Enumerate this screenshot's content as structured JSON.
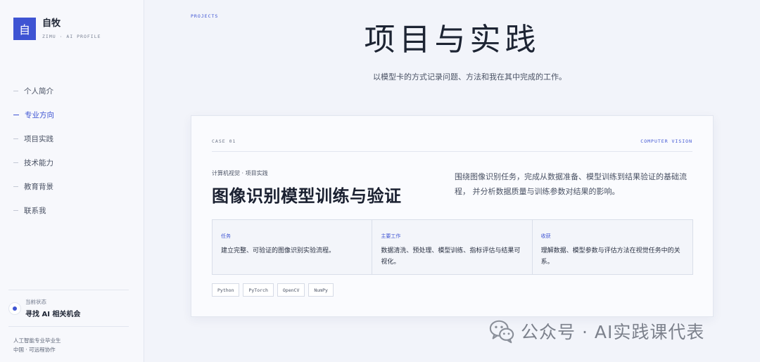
{
  "sidebar": {
    "logo_char": "自",
    "brand_name": "自牧",
    "brand_sub": "ZIMU · AI PROFILE",
    "items": [
      {
        "label": "个人简介"
      },
      {
        "label": "专业方向"
      },
      {
        "label": "项目实践"
      },
      {
        "label": "技术能力"
      },
      {
        "label": "教育背景"
      },
      {
        "label": "联系我"
      }
    ],
    "status_label": "当前状态",
    "status_value": "寻找 AI 相关机会",
    "foot_line1": "人工智能专业毕业生",
    "foot_line2": "中国 · 可远程协作"
  },
  "main": {
    "kicker": "PROJECTS",
    "title": "项目与实践",
    "subtitle": "以模型卡的方式记录问题、方法和我在其中完成的工作。"
  },
  "card": {
    "case_no": "CASE 01",
    "case_tag": "COMPUTER VISION",
    "crumb": "计算机视觉 · 项目实践",
    "title": "图像识别模型训练与验证",
    "description": "围绕图像识别任务，完成从数据准备、模型训练到结果验证的基础流程， 并分析数据质量与训练参数对结果的影响。",
    "cells": [
      {
        "title": "任务",
        "text": "建立完整、可验证的图像识别实验流程。"
      },
      {
        "title": "主要工作",
        "text": "数据清洗、预处理、模型训练、指标评估与结果可视化。"
      },
      {
        "title": "收获",
        "text": "理解数据、模型参数与评估方法在视觉任务中的关系。"
      }
    ],
    "tags": [
      "Python",
      "PyTorch",
      "OpenCV",
      "NumPy"
    ]
  },
  "watermark": {
    "text": "公众号 · AI实践课代表"
  },
  "colors": {
    "accent": "#3e54d3",
    "background": "#f2f4fa",
    "sidebar": "#f7f8fc"
  }
}
